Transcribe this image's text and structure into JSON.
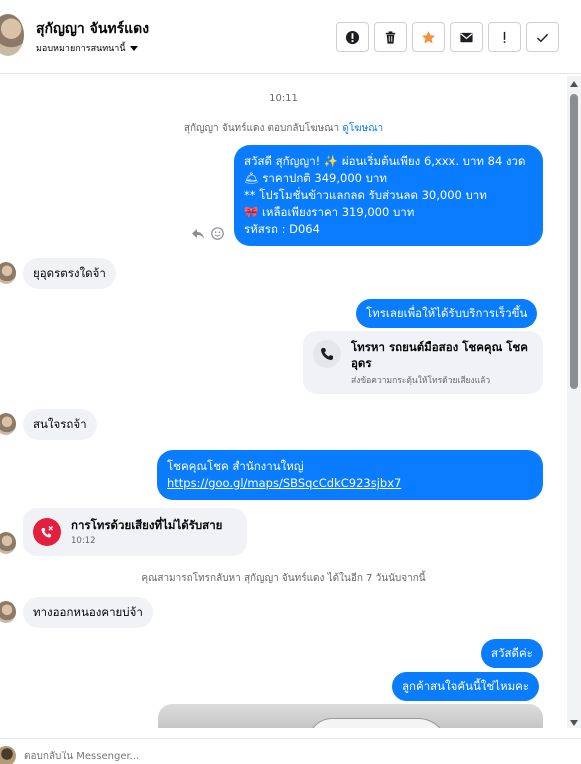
{
  "header": {
    "contact_name": "สุกัญญา จันทร์แดง",
    "assign_label": "มอบหมายการสนทนานี้",
    "tools": [
      "report-icon",
      "trash-icon",
      "star-icon",
      "mail-icon",
      "exclamation-icon",
      "check-icon"
    ],
    "star_color": "#f7923b"
  },
  "thread": {
    "time_1": "10:11",
    "reply_note_prefix": "สุกัญญา จันทร์แดง ตอบกลับโฆษณา",
    "reply_note_link": "ดูโฆษณา",
    "ad_message": {
      "lines": [
        "สวัสดี สุกัญญา! ✨  ผ่อนเริ่มต้นเพียง 6,xxx. บาท 84 งวด",
        "🛎 ราคาปกติ 349,000 บาท",
        "** โปรโมชั่นข้าวแลกลด รับส่วนลด 30,000 บาท",
        "🎀  เหลือเพียงราคา 319,000 บาท",
        " รหัสรถ : D064"
      ]
    },
    "msg_in_1": "ยุอุดรตรงใดจ้า",
    "msg_out_1": "โทรเลยเพื่อให้ได้รับบริการเร็วขึ้น",
    "call_card": {
      "title": "โทรหา รถยนต์มือสอง โชคคุณ โชค อุดร",
      "subtitle": "ส่งข้อความกระตุ้นให้โทรด้วยเสียงแล้ว"
    },
    "msg_in_2": "สนใจรถจ้า",
    "msg_out_2_line1": "โชคคุณโชค สำนักงานใหญ่",
    "msg_out_2_link": "https://goo.gl/maps/SBSqcCdkC923sjbx7",
    "missed_call": {
      "title": "การโทรด้วยเสียงที่ไม่ได้รับสาย",
      "time": "10:12"
    },
    "callback_note": "คุณสามารถโทรกลับหา สุกัญญา จันทร์แดง ได้ในอีก 7 วันนับจากนี้",
    "msg_in_3": "ทางออกหนองคายบ่จ้า",
    "msg_out_3": "สวัสดีค่ะ",
    "msg_out_4": "ลูกค้าสนใจคันนี้ใช่ไหมคะ",
    "accent_color": "#0a7cff"
  },
  "composer": {
    "placeholder": "ตอบกลับใน Messenger..."
  }
}
